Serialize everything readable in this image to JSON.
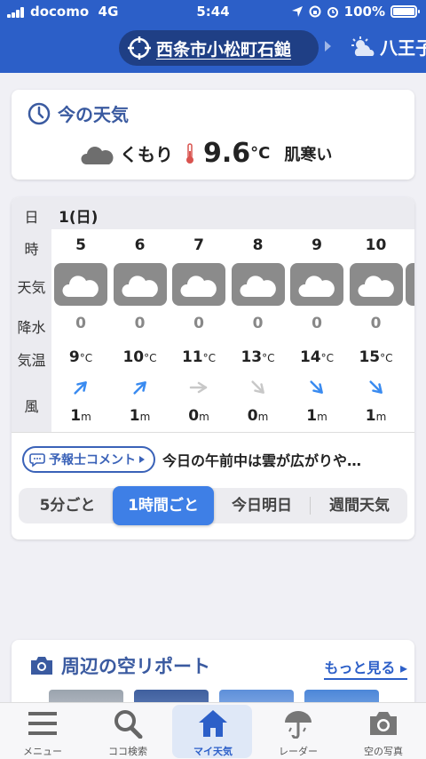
{
  "status": {
    "carrier": "docomo",
    "network": "4G",
    "time": "5:44",
    "battery": "100%"
  },
  "header": {
    "location": "西条市小松町石鎚",
    "next_location": "八王子"
  },
  "current": {
    "title": "今の天気",
    "icon": "cloud-icon",
    "condition": "くもり",
    "temp": "9.6",
    "unit": "°C",
    "feel": "肌寒い"
  },
  "hourly": {
    "day": "1(日)",
    "row_labels": {
      "day": "日",
      "hour": "時",
      "weather": "天気",
      "precip": "降水",
      "temp": "気温",
      "wind": "風"
    },
    "hours": [
      {
        "hour": "5",
        "icon": "cloud-icon",
        "precip": "0",
        "temp": "9",
        "wind_dir": "northeast",
        "wind": "1"
      },
      {
        "hour": "6",
        "icon": "cloud-icon",
        "precip": "0",
        "temp": "10",
        "wind_dir": "northeast",
        "wind": "1"
      },
      {
        "hour": "7",
        "icon": "cloud-icon",
        "precip": "0",
        "temp": "11",
        "wind_dir": "east",
        "wind": "0"
      },
      {
        "hour": "8",
        "icon": "cloud-icon",
        "precip": "0",
        "temp": "13",
        "wind_dir": "southeast",
        "wind": "0"
      },
      {
        "hour": "9",
        "icon": "cloud-icon",
        "precip": "0",
        "temp": "14",
        "wind_dir": "southeast",
        "wind": "1"
      },
      {
        "hour": "10",
        "icon": "cloud-icon",
        "precip": "0",
        "temp": "15",
        "wind_dir": "southeast",
        "wind": "1"
      }
    ],
    "temp_unit": "°C",
    "wind_unit": "m",
    "comment_tag": "予報士コメント",
    "comment": "今日の午前中は雲が広がりや…",
    "segments": [
      "5分ごと",
      "1時間ごと",
      "今日明日",
      "週間天気"
    ],
    "active_segment": "1時間ごと"
  },
  "nearby": {
    "title": "周辺の空リポート",
    "more": "もっと見る"
  },
  "tabbar": [
    {
      "label": "メニュー",
      "icon": "menu-icon"
    },
    {
      "label": "ココ検索",
      "icon": "search-icon"
    },
    {
      "label": "マイ天気",
      "icon": "home-icon"
    },
    {
      "label": "レーダー",
      "icon": "radar-icon"
    },
    {
      "label": "空の写真",
      "icon": "camera-icon"
    }
  ],
  "colors": {
    "header": "#2c5fc8",
    "accent": "#3e7fe6"
  }
}
